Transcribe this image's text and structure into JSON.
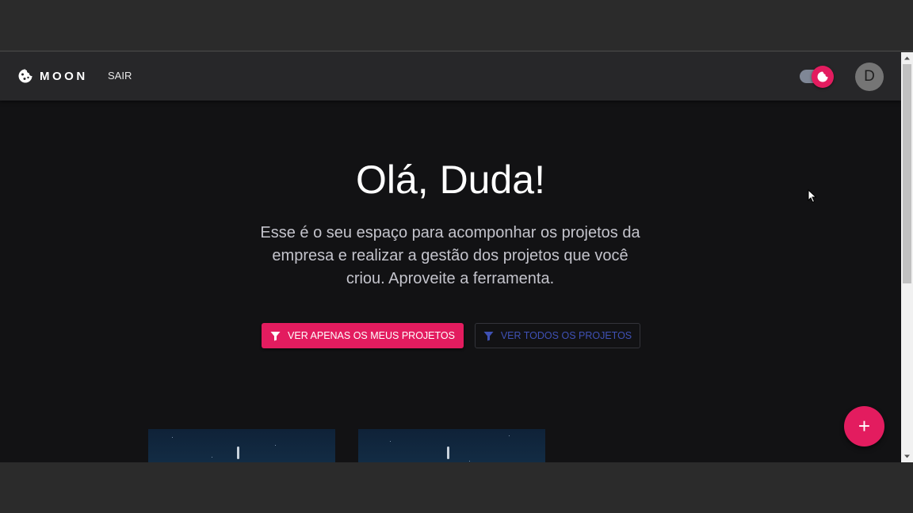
{
  "appbar": {
    "brand": "MOON",
    "logout_label": "SAIR",
    "user_initial": "D"
  },
  "hero": {
    "title": "Olá, Duda!",
    "description": "Esse é o seu espaço para acomponhar os projetos da empresa e realizar a gestão dos projetos que você criou. Aproveite a ferramenta."
  },
  "filters": {
    "mine_label": "VER APENAS OS MEUS PROJETOS",
    "all_label": "VER TODOS OS PROJETOS"
  },
  "fab": {
    "label": "+"
  },
  "icons": {
    "logo": "cookie-icon",
    "theme": "dark-mode-icon",
    "filter": "filter-icon",
    "add": "add-icon"
  },
  "colors": {
    "accent": "#e31c5f",
    "secondary": "#3f51b5",
    "background": "#121214",
    "appbar": "#272729"
  }
}
